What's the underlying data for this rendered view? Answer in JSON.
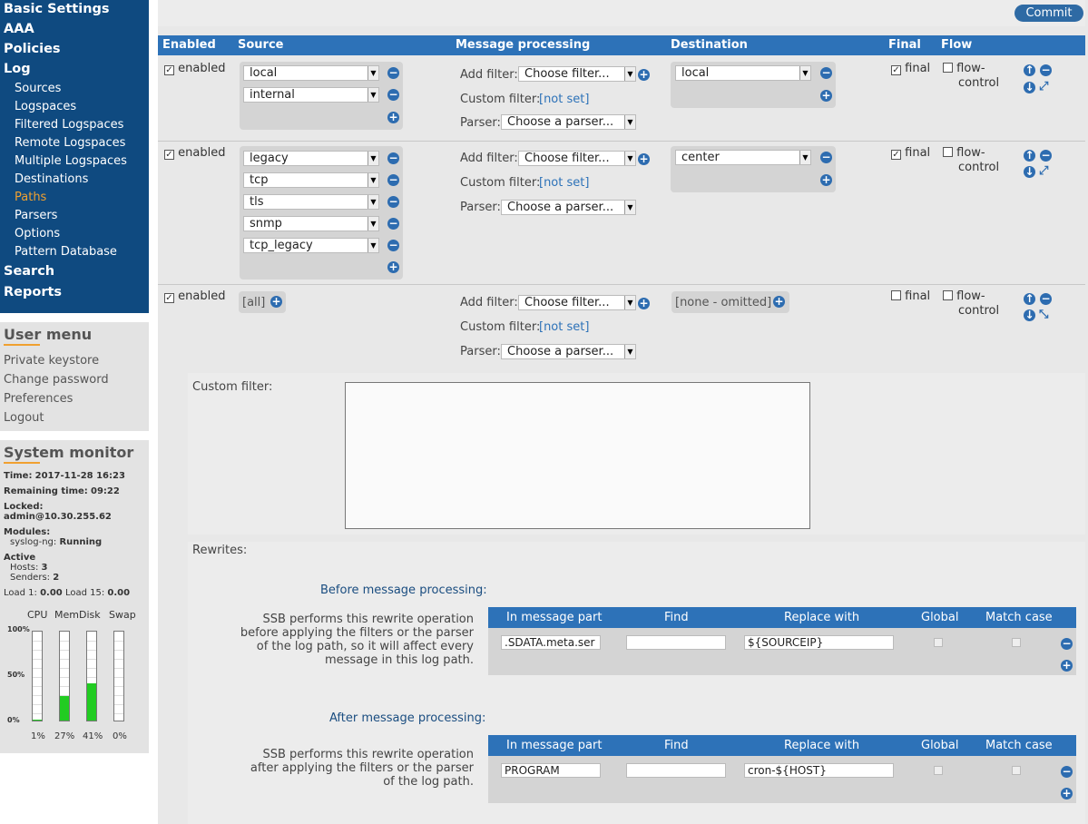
{
  "nav": {
    "basic": "Basic Settings",
    "aaa": "AAA",
    "policies": "Policies",
    "log": "Log",
    "log_items": [
      "Sources",
      "Logspaces",
      "Filtered Logspaces",
      "Remote Logspaces",
      "Multiple Logspaces",
      "Destinations",
      "Paths",
      "Parsers",
      "Options",
      "Pattern Database"
    ],
    "search": "Search",
    "reports": "Reports"
  },
  "user_menu": {
    "title": "User menu",
    "items": [
      "Private keystore",
      "Change password",
      "Preferences",
      "Logout"
    ]
  },
  "monitor": {
    "title": "System monitor",
    "time_label": "Time:",
    "time": "2017-11-28 16:23",
    "remaining_label": "Remaining time:",
    "remaining": "09:22",
    "locked_label": "Locked:",
    "locked": "admin@10.30.255.62",
    "modules_label": "Modules:",
    "module": "syslog-ng:",
    "module_status": "Running",
    "active_label": "Active",
    "hosts_label": "Hosts:",
    "hosts": "3",
    "senders_label": "Senders:",
    "senders": "2",
    "load1_label": "Load 1:",
    "load1": "0.00",
    "load15_label": "Load 15:",
    "load15": "0.00",
    "bars": [
      {
        "label": "CPU",
        "value": "1%",
        "fill": 0.01
      },
      {
        "label": "Mem",
        "value": "27%",
        "fill": 0.27
      },
      {
        "label": "Disk",
        "value": "41%",
        "fill": 0.41
      },
      {
        "label": "Swap",
        "value": "0%",
        "fill": 0
      }
    ],
    "y100": "100%",
    "y50": "50%",
    "y0": "0%"
  },
  "commit": "Commit",
  "table": {
    "headers": {
      "enabled": "Enabled",
      "source": "Source",
      "msg": "Message processing",
      "dest": "Destination",
      "final": "Final",
      "flow": "Flow"
    }
  },
  "common": {
    "enabled": "enabled",
    "final": "final",
    "flow1": "flow-",
    "flow2": "control",
    "add_filter": "Add filter:",
    "custom_filter": "Custom filter:",
    "parser": "Parser:",
    "choose_filter": "Choose filter...",
    "choose_parser": "Choose a parser...",
    "not_set": "[not set]"
  },
  "rows": [
    {
      "sources": [
        "local",
        "internal"
      ],
      "dest": "local"
    },
    {
      "sources": [
        "legacy",
        "tcp",
        "tls",
        "snmp",
        "tcp_legacy"
      ],
      "dest": "center"
    },
    {
      "sources_all": "[all]",
      "dest_none": "[none - omitted]"
    }
  ],
  "detail": {
    "custom_filter": "Custom filter:",
    "rewrites": "Rewrites:",
    "before_title": "Before message processing:",
    "before_desc": [
      "SSB performs this rewrite operation",
      "before applying the filters or the parser",
      "of the log path, so it will affect every",
      "message in this log path."
    ],
    "after_title": "After message processing:",
    "after_desc": [
      "SSB performs this rewrite operation",
      "after applying the filters or the parser",
      "of the log path."
    ],
    "cols": {
      "part": "In message part",
      "find": "Find",
      "replace": "Replace with",
      "global": "Global",
      "match": "Match case"
    },
    "before_row": {
      "part": ".SDATA.meta.ser",
      "find": "",
      "replace": "${SOURCEIP}"
    },
    "after_row": {
      "part": "PROGRAM",
      "find": "",
      "replace": "cron-${HOST}"
    }
  }
}
